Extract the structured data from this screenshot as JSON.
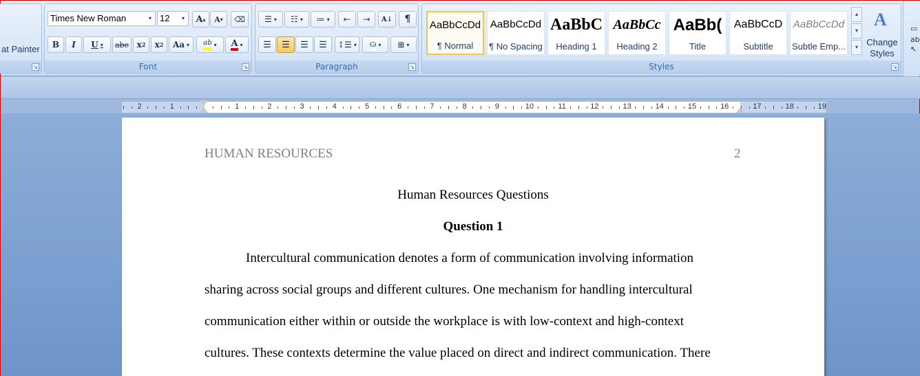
{
  "clipboard": {
    "format_painter_label": "at Painter"
  },
  "font": {
    "group_label": "Font",
    "font_name": "Times New Roman",
    "font_size": "12",
    "grow_label": "A",
    "shrink_label": "A",
    "bold_label": "B",
    "italic_label": "I",
    "underline_label": "U",
    "strike_label": "abe",
    "subscript_label": "x",
    "superscript_label": "x",
    "case_label": "Aa",
    "highlight_label": "ab",
    "font_color_label": "A",
    "highlight_color": "#ffff00",
    "font_color": "#e00000"
  },
  "paragraph": {
    "group_label": "Paragraph"
  },
  "styles": {
    "group_label": "Styles",
    "change_styles_label": "Change Styles",
    "items": [
      {
        "sample": "AaBbCcDd",
        "name": "¶ Normal"
      },
      {
        "sample": "AaBbCcDd",
        "name": "¶ No Spacing"
      },
      {
        "sample": "AaBbC",
        "name": "Heading 1"
      },
      {
        "sample": "AaBbCc",
        "name": "Heading 2"
      },
      {
        "sample": "AaBb(",
        "name": "Title"
      },
      {
        "sample": "AaBbCcD",
        "name": "Subtitle"
      },
      {
        "sample": "AaBbCcDd",
        "name": "Subtle Emp..."
      }
    ]
  },
  "ruler": {
    "numbers_left": [
      "2",
      "1"
    ],
    "numbers_right": [
      "1",
      "2",
      "3",
      "4",
      "5",
      "6",
      "7",
      "8",
      "9",
      "10",
      "11",
      "12",
      "13",
      "14",
      "15",
      "16",
      "17",
      "18",
      "19"
    ]
  },
  "document": {
    "header_left": "HUMAN RESOURCES",
    "header_right": "2",
    "title": "Human Resources Questions",
    "heading": "Question 1",
    "lines": [
      "Intercultural communication denotes a form of communication involving information",
      "sharing across social groups and different cultures. One mechanism for handling intercultural",
      "communication either within or outside the workplace is with low-context and high-context",
      "cultures. These contexts determine the value placed on direct and indirect communication. There"
    ]
  }
}
